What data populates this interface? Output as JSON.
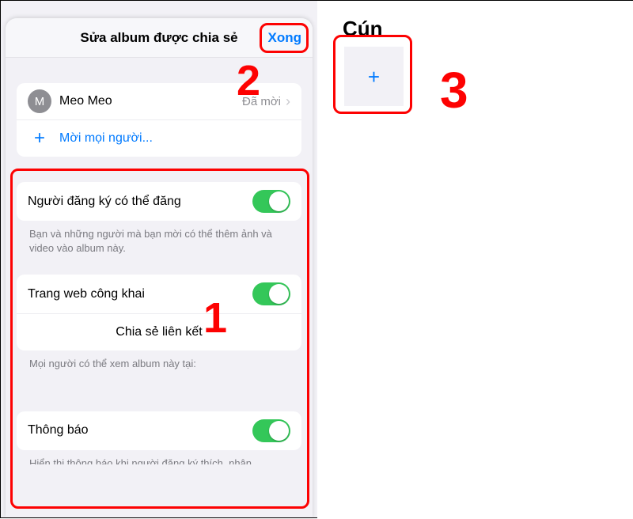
{
  "sheet": {
    "title": "Sửa album được chia sẻ",
    "done_label": "Xong",
    "people": {
      "member": {
        "initial": "M",
        "name": "Meo Meo",
        "status": "Đã mời"
      },
      "invite_label": "Mời mọi người..."
    },
    "subscribers": {
      "toggle_label": "Người đăng ký có thể đăng",
      "footer": "Bạn và những người mà bạn mời có thể thêm ảnh và video vào album này."
    },
    "public_web": {
      "toggle_label": "Trang web công khai",
      "share_link_label": "Chia sẻ liên kết",
      "footer": "Mọi người có thể xem album này tại:"
    },
    "notifications": {
      "toggle_label": "Thông báo",
      "footer": "Hiển thị thông báo khi người đăng ký thích, nhận"
    }
  },
  "right": {
    "album_title": "Cún",
    "add_icon": "+"
  },
  "annotations": {
    "n1": "1",
    "n2": "2",
    "n3": "3"
  }
}
